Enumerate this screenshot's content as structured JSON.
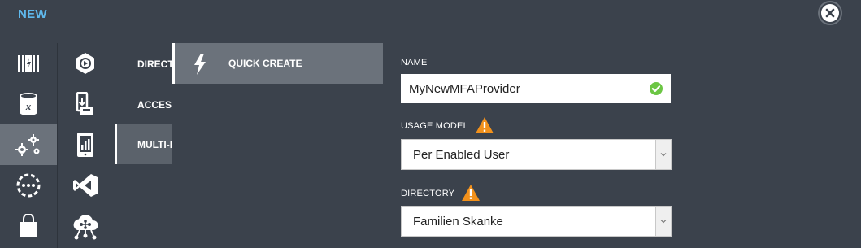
{
  "header": {
    "title": "NEW"
  },
  "close": {
    "icon": "close-icon"
  },
  "columns": {
    "primary": [
      {
        "icon": "data-services-icon"
      },
      {
        "icon": "sql-database-icon"
      },
      {
        "icon": "app-services-icon",
        "selected": true
      },
      {
        "icon": "dashed-circle-icon"
      },
      {
        "icon": "store-bag-icon"
      }
    ],
    "secondary": [
      {
        "icon": "media-services-icon"
      },
      {
        "icon": "mobile-deploy-icon"
      },
      {
        "icon": "mobile-device-icon"
      },
      {
        "icon": "visual-studio-icon"
      },
      {
        "icon": "cloud-network-icon"
      }
    ],
    "categories": [
      {
        "label": "DIRECTORY"
      },
      {
        "label": "ACCESS CONTROL"
      },
      {
        "label": "MULTI-FACTOR AUTH",
        "selected": true
      }
    ]
  },
  "quick_create": {
    "label": "QUICK CREATE",
    "icon": "lightning-icon"
  },
  "form": {
    "name": {
      "label": "NAME",
      "value": "MyNewMFAProvider",
      "status_icon": "check-circle-icon"
    },
    "usage_model": {
      "label": "USAGE MODEL",
      "warning_icon": "warning-icon",
      "value": "Per Enabled User"
    },
    "directory": {
      "label": "DIRECTORY",
      "warning_icon": "warning-icon",
      "value": "Familien Skanke"
    }
  },
  "colors": {
    "accent": "#5fb8ec",
    "background": "#3b424c",
    "selected": "#6b727b",
    "success": "#6cc644",
    "warning": "#f2911b"
  }
}
